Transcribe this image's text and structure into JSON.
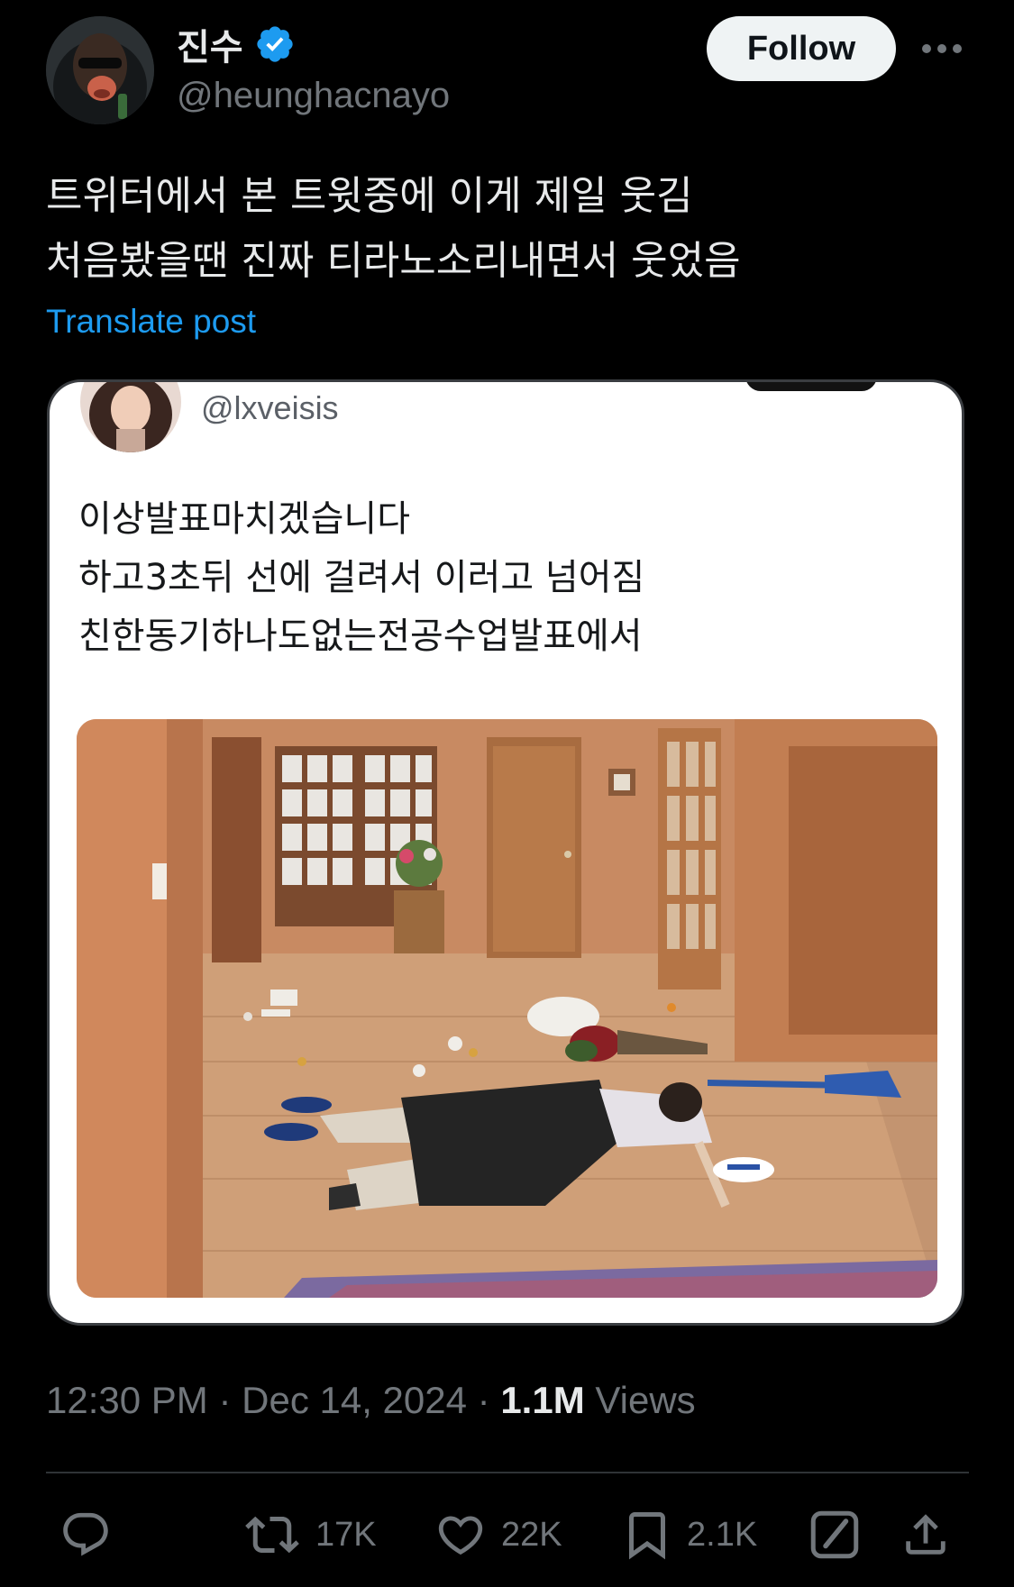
{
  "author": {
    "display_name": "진수",
    "handle": "@heunghacnayo",
    "verified": true
  },
  "follow_label": "Follow",
  "post": {
    "lines": [
      "트위터에서 본 트윗중에 이게 제일 웃김",
      "처음봤을땐 진짜 티라노소리내면서 웃었음"
    ],
    "translate_label": "Translate post"
  },
  "embedded": {
    "handle": "@lxveisis",
    "lines": [
      "이상발표마치겠습니다",
      "하고3초뒤 선에 걸려서 이러고 넘어짐",
      "친한동기하나도없는전공수업발표에서"
    ]
  },
  "meta": {
    "time": "12:30 PM",
    "separator": "·",
    "date": "Dec 14, 2024",
    "views_count": "1.1M",
    "views_label": "Views"
  },
  "actions": {
    "reply": {
      "icon": "reply-icon",
      "count": ""
    },
    "repost": {
      "icon": "repost-icon",
      "count": "17K"
    },
    "like": {
      "icon": "heart-icon",
      "count": "22K"
    },
    "bookmark": {
      "icon": "bookmark-icon",
      "count": "2.1K"
    },
    "grok": {
      "icon": "grok-icon"
    },
    "share": {
      "icon": "share-icon"
    }
  },
  "colors": {
    "background": "#000000",
    "link": "#1d9bf0",
    "verified": "#1d9bf0",
    "muted": "#71767b",
    "follow_bg": "#eff3f4"
  }
}
